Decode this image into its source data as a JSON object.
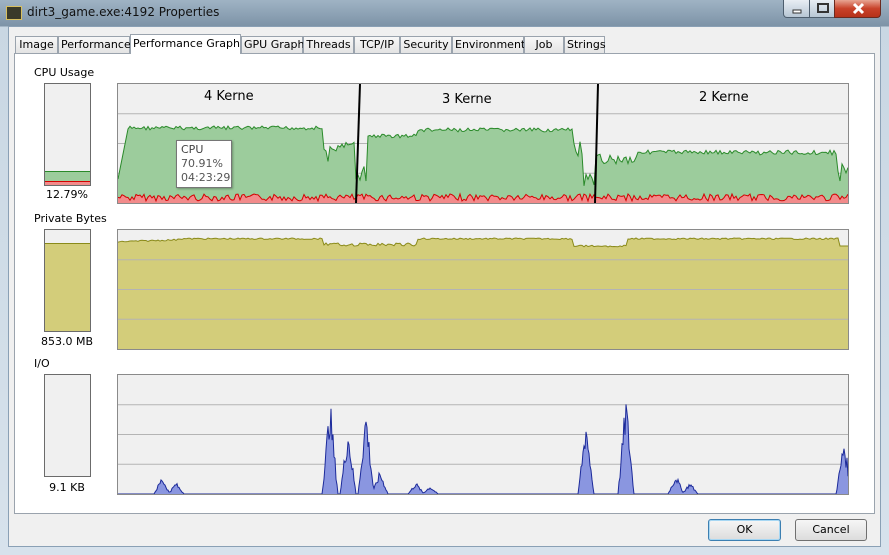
{
  "window": {
    "title": "dirt3_game.exe:4192 Properties"
  },
  "tabs": [
    "Image",
    "Performance",
    "Performance Graph",
    "GPU Graph",
    "Threads",
    "TCP/IP",
    "Security",
    "Environment",
    "Job",
    "Strings"
  ],
  "active_tab": "Performance Graph",
  "cpu": {
    "label": "CPU Usage",
    "value_text": "12.79%",
    "value_fraction": 0.1279,
    "segments": [
      "4 Kerne",
      "3 Kerne",
      "2 Kerne"
    ],
    "tooltip": {
      "title": "CPU",
      "value": "70.91%",
      "time": "04:23:29"
    },
    "colors": {
      "total": "#9ccc9c",
      "total_line": "#2a8a2a",
      "kernel": "#f28b8b",
      "kernel_line": "#d40000"
    }
  },
  "private_bytes": {
    "label": "Private Bytes",
    "value_text": "853.0 MB",
    "color": "#d3cd7a",
    "line": "#8a8a1a"
  },
  "io": {
    "label": "I/O",
    "value_text": "9.1  KB",
    "color": "#8a96e0",
    "line": "#1c2a9a"
  },
  "buttons": {
    "ok": "OK",
    "cancel": "Cancel"
  }
}
